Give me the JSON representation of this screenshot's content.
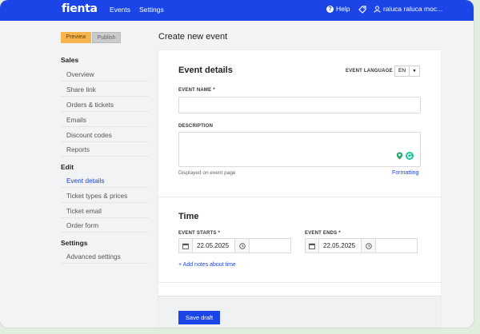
{
  "topbar": {
    "logo": "fienta",
    "nav": {
      "events": "Events",
      "settings": "Settings"
    },
    "help": "Help",
    "user": "raluca raluca moc..."
  },
  "actions": {
    "preview": "Preview",
    "publish": "Publish"
  },
  "sidebar": {
    "sales_heading": "Sales",
    "sales_items": [
      "Overview",
      "Share link",
      "Orders & tickets",
      "Emails",
      "Discount codes",
      "Reports"
    ],
    "edit_heading": "Edit",
    "edit_items": [
      "Event details",
      "Ticket types & prices",
      "Ticket email",
      "Order form"
    ],
    "settings_heading": "Settings",
    "settings_items": [
      "Advanced settings"
    ],
    "active_item": "Event details"
  },
  "page": {
    "title": "Create new event"
  },
  "event_details": {
    "heading": "Event details",
    "language_label": "EVENT LANGUAGE",
    "language_value": "EN",
    "name_label": "EVENT NAME *",
    "name_value": "",
    "description_label": "DESCRIPTION",
    "description_value": "",
    "description_hint": "Displayed on event page",
    "formatting_link": "Formatting"
  },
  "time": {
    "heading": "Time",
    "starts_label": "EVENT STARTS *",
    "starts_date": "22.05.2025",
    "starts_time": "",
    "ends_label": "EVENT ENDS *",
    "ends_date": "22.05.2025",
    "ends_time": "",
    "add_notes_link": "+ Add notes about time"
  },
  "footer": {
    "save_draft": "Save draft"
  },
  "colors": {
    "brand": "#1b45e6",
    "preview": "#f5b54c"
  }
}
